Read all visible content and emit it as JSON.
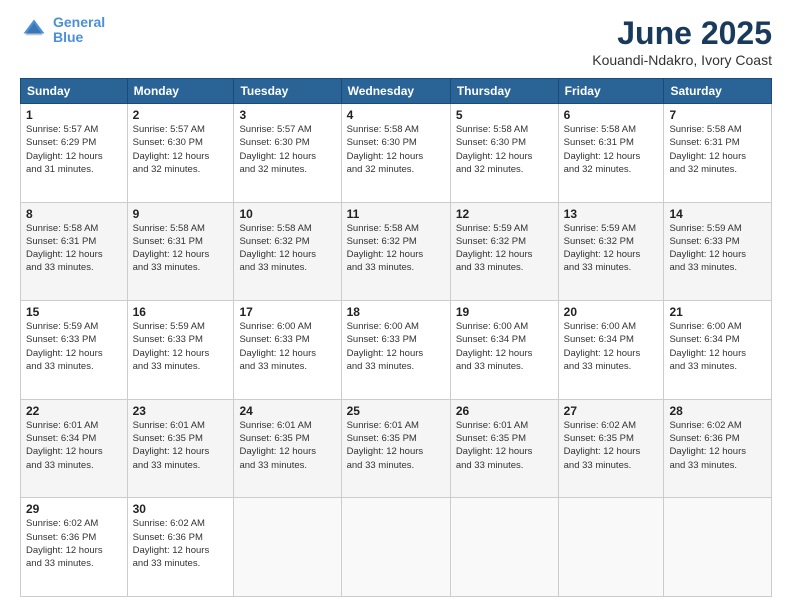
{
  "header": {
    "logo_line1": "General",
    "logo_line2": "Blue",
    "title": "June 2025",
    "subtitle": "Kouandi-Ndakro, Ivory Coast"
  },
  "columns": [
    "Sunday",
    "Monday",
    "Tuesday",
    "Wednesday",
    "Thursday",
    "Friday",
    "Saturday"
  ],
  "weeks": [
    [
      {
        "day": "1",
        "info": "Sunrise: 5:57 AM\nSunset: 6:29 PM\nDaylight: 12 hours\nand 31 minutes."
      },
      {
        "day": "2",
        "info": "Sunrise: 5:57 AM\nSunset: 6:30 PM\nDaylight: 12 hours\nand 32 minutes."
      },
      {
        "day": "3",
        "info": "Sunrise: 5:57 AM\nSunset: 6:30 PM\nDaylight: 12 hours\nand 32 minutes."
      },
      {
        "day": "4",
        "info": "Sunrise: 5:58 AM\nSunset: 6:30 PM\nDaylight: 12 hours\nand 32 minutes."
      },
      {
        "day": "5",
        "info": "Sunrise: 5:58 AM\nSunset: 6:30 PM\nDaylight: 12 hours\nand 32 minutes."
      },
      {
        "day": "6",
        "info": "Sunrise: 5:58 AM\nSunset: 6:31 PM\nDaylight: 12 hours\nand 32 minutes."
      },
      {
        "day": "7",
        "info": "Sunrise: 5:58 AM\nSunset: 6:31 PM\nDaylight: 12 hours\nand 32 minutes."
      }
    ],
    [
      {
        "day": "8",
        "info": "Sunrise: 5:58 AM\nSunset: 6:31 PM\nDaylight: 12 hours\nand 33 minutes."
      },
      {
        "day": "9",
        "info": "Sunrise: 5:58 AM\nSunset: 6:31 PM\nDaylight: 12 hours\nand 33 minutes."
      },
      {
        "day": "10",
        "info": "Sunrise: 5:58 AM\nSunset: 6:32 PM\nDaylight: 12 hours\nand 33 minutes."
      },
      {
        "day": "11",
        "info": "Sunrise: 5:58 AM\nSunset: 6:32 PM\nDaylight: 12 hours\nand 33 minutes."
      },
      {
        "day": "12",
        "info": "Sunrise: 5:59 AM\nSunset: 6:32 PM\nDaylight: 12 hours\nand 33 minutes."
      },
      {
        "day": "13",
        "info": "Sunrise: 5:59 AM\nSunset: 6:32 PM\nDaylight: 12 hours\nand 33 minutes."
      },
      {
        "day": "14",
        "info": "Sunrise: 5:59 AM\nSunset: 6:33 PM\nDaylight: 12 hours\nand 33 minutes."
      }
    ],
    [
      {
        "day": "15",
        "info": "Sunrise: 5:59 AM\nSunset: 6:33 PM\nDaylight: 12 hours\nand 33 minutes."
      },
      {
        "day": "16",
        "info": "Sunrise: 5:59 AM\nSunset: 6:33 PM\nDaylight: 12 hours\nand 33 minutes."
      },
      {
        "day": "17",
        "info": "Sunrise: 6:00 AM\nSunset: 6:33 PM\nDaylight: 12 hours\nand 33 minutes."
      },
      {
        "day": "18",
        "info": "Sunrise: 6:00 AM\nSunset: 6:33 PM\nDaylight: 12 hours\nand 33 minutes."
      },
      {
        "day": "19",
        "info": "Sunrise: 6:00 AM\nSunset: 6:34 PM\nDaylight: 12 hours\nand 33 minutes."
      },
      {
        "day": "20",
        "info": "Sunrise: 6:00 AM\nSunset: 6:34 PM\nDaylight: 12 hours\nand 33 minutes."
      },
      {
        "day": "21",
        "info": "Sunrise: 6:00 AM\nSunset: 6:34 PM\nDaylight: 12 hours\nand 33 minutes."
      }
    ],
    [
      {
        "day": "22",
        "info": "Sunrise: 6:01 AM\nSunset: 6:34 PM\nDaylight: 12 hours\nand 33 minutes."
      },
      {
        "day": "23",
        "info": "Sunrise: 6:01 AM\nSunset: 6:35 PM\nDaylight: 12 hours\nand 33 minutes."
      },
      {
        "day": "24",
        "info": "Sunrise: 6:01 AM\nSunset: 6:35 PM\nDaylight: 12 hours\nand 33 minutes."
      },
      {
        "day": "25",
        "info": "Sunrise: 6:01 AM\nSunset: 6:35 PM\nDaylight: 12 hours\nand 33 minutes."
      },
      {
        "day": "26",
        "info": "Sunrise: 6:01 AM\nSunset: 6:35 PM\nDaylight: 12 hours\nand 33 minutes."
      },
      {
        "day": "27",
        "info": "Sunrise: 6:02 AM\nSunset: 6:35 PM\nDaylight: 12 hours\nand 33 minutes."
      },
      {
        "day": "28",
        "info": "Sunrise: 6:02 AM\nSunset: 6:36 PM\nDaylight: 12 hours\nand 33 minutes."
      }
    ],
    [
      {
        "day": "29",
        "info": "Sunrise: 6:02 AM\nSunset: 6:36 PM\nDaylight: 12 hours\nand 33 minutes."
      },
      {
        "day": "30",
        "info": "Sunrise: 6:02 AM\nSunset: 6:36 PM\nDaylight: 12 hours\nand 33 minutes."
      },
      {
        "day": "",
        "info": ""
      },
      {
        "day": "",
        "info": ""
      },
      {
        "day": "",
        "info": ""
      },
      {
        "day": "",
        "info": ""
      },
      {
        "day": "",
        "info": ""
      }
    ]
  ]
}
